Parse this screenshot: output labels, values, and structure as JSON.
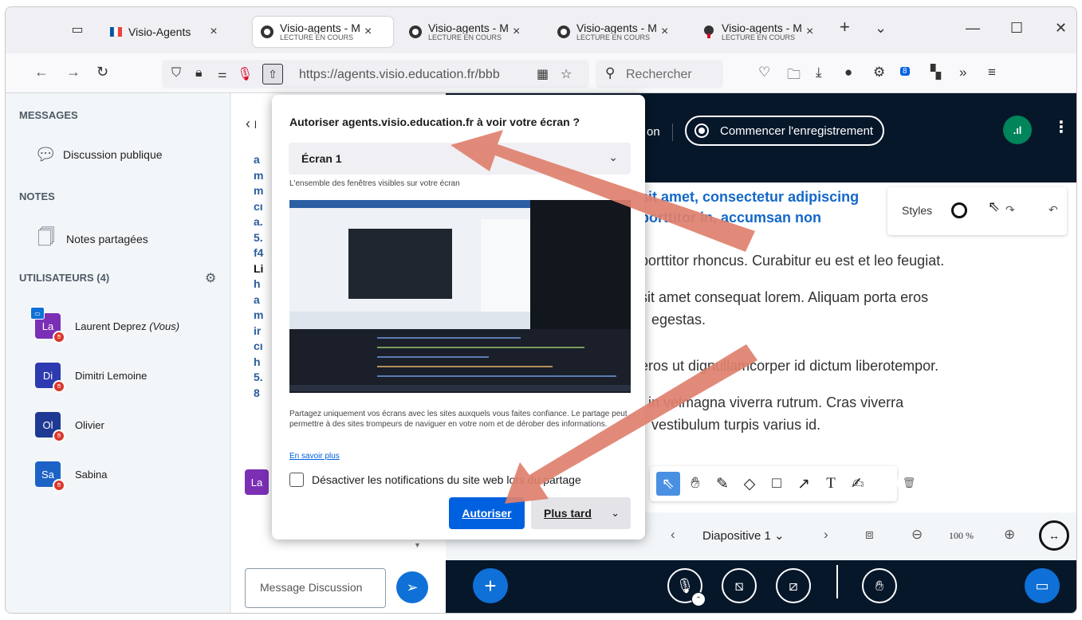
{
  "browser": {
    "tabs": [
      {
        "title": "Visio-Agents",
        "subtitle": ""
      },
      {
        "title": "Visio-agents - M",
        "subtitle": "LECTURE EN COURS"
      },
      {
        "title": "Visio-agents - M",
        "subtitle": "LECTURE EN COURS"
      },
      {
        "title": "Visio-agents - M",
        "subtitle": "LECTURE EN COURS"
      },
      {
        "title": "Visio-agents - M",
        "subtitle": "LECTURE EN COURS"
      }
    ],
    "new_tab": "+",
    "url": "https://agents.visio.education.fr/bbb",
    "search_placeholder": "Rechercher",
    "extension_badge": "8"
  },
  "sidebar": {
    "messages_title": "MESSAGES",
    "public_chat": "Discussion publique",
    "notes_title": "NOTES",
    "shared_notes": "Notes partagées",
    "users_title": "UTILISATEURS (4)",
    "users": [
      {
        "initials": "La",
        "name": "Laurent Deprez",
        "you": "(Vous)",
        "color": "#7b2fb5",
        "presenter": true
      },
      {
        "initials": "Di",
        "name": "Dimitri Lemoine",
        "you": "",
        "color": "#2d3ab0",
        "presenter": false
      },
      {
        "initials": "Ol",
        "name": "Olivier",
        "you": "",
        "color": "#1f3a93",
        "presenter": false
      },
      {
        "initials": "Sa",
        "name": "Sabina",
        "you": "",
        "color": "#1d63c7",
        "presenter": false
      }
    ]
  },
  "chat": {
    "back_label": "l",
    "line_starts": [
      "a",
      "m",
      "m",
      "cı",
      "a.",
      "5.",
      "f4",
      "Li",
      "h",
      "a",
      "m",
      "ir",
      "cı",
      "h",
      "5.",
      "8"
    ],
    "last_author_initials": "La",
    "input_placeholder": "Message Discussion"
  },
  "meeting": {
    "topbar_partial": "on",
    "record_label": "Commencer l'enregistrement",
    "slide_heading": [
      "sit amet, consectetur adipiscing",
      "porttitor in, accumsan non"
    ],
    "slide_body": [
      "porttitor rhoncus. Curabitur eu est et leo feugiat.",
      "sit amet consequat lorem. Aliquam porta eros",
      "egestas.",
      "eros ut dignullamcorper id dictum liberotempor.",
      "t in velmagna viverra rutrum. Cras viverra",
      "vestibulum turpis varius id."
    ],
    "styles_label": "Styles",
    "slide_label": "Diapositive 1",
    "zoom": "100 %"
  },
  "dialog": {
    "title": "Autoriser agents.visio.education.fr à voir votre écran ?",
    "selected_screen": "Écran 1",
    "description": "L'ensemble des fenêtres visibles sur votre écran",
    "warning": "Partagez uniquement vos écrans avec les sites auxquels vous faites confiance. Le partage peut permettre à des sites trompeurs de naviguer en votre nom et de dérober des informations.",
    "learn_more": "En savoir plus",
    "checkbox_label": "Désactiver les notifications du site web lors du partage",
    "allow_button": "Autoriser",
    "later_button": "Plus tard"
  },
  "colors": {
    "accent_blue": "#0061e0",
    "meeting_dark": "#06172a",
    "annotation_arrow": "#e0806e",
    "record_green": "#00845a"
  }
}
